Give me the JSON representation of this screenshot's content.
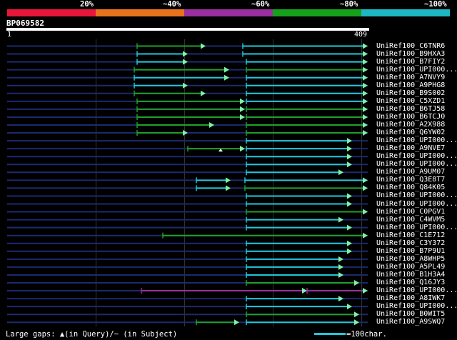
{
  "percent_scale": {
    "labels": [
      "20%",
      "~40%",
      "~60%",
      "~80%",
      "~100%"
    ],
    "colors": [
      "#e8163a",
      "#e9731d",
      "#9a2f9f",
      "#16a11c",
      "#1cb9c4"
    ]
  },
  "query": {
    "name": "BP069582",
    "start": "1",
    "end": "409"
  },
  "hits": [
    {
      "label": "UniRef100_C6TNR6"
    },
    {
      "label": "UniRef100_B9HXA3"
    },
    {
      "label": "UniRef100_B7FIY2"
    },
    {
      "label": "UniRef100_UPI000..."
    },
    {
      "label": "UniRef100_A7NVY9"
    },
    {
      "label": "UniRef100_A9PHG8"
    },
    {
      "label": "UniRef100_B9S002"
    },
    {
      "label": "UniRef100_C5XZD1"
    },
    {
      "label": "UniRef100_B6TJ58"
    },
    {
      "label": "UniRef100_B6TCJ0"
    },
    {
      "label": "UniRef100_A2X988"
    },
    {
      "label": "UniRef100_Q6YW02"
    },
    {
      "label": "UniRef100_UPI000..."
    },
    {
      "label": "UniRef100_A9NVE7"
    },
    {
      "label": "UniRef100_UPI000..."
    },
    {
      "label": "UniRef100_UPI000..."
    },
    {
      "label": "UniRef100_A9UM07"
    },
    {
      "label": "UniRef100_Q3E8T7"
    },
    {
      "label": "UniRef100_Q84K05"
    },
    {
      "label": "UniRef100_UPI000..."
    },
    {
      "label": "UniRef100_UPI000..."
    },
    {
      "label": "UniRef100_C0PGV1"
    },
    {
      "label": "UniRef100_C4WVM5"
    },
    {
      "label": "UniRef100_UPI000..."
    },
    {
      "label": "UniRef100_C1E712"
    },
    {
      "label": "UniRef100_C3Y372"
    },
    {
      "label": "UniRef100_B7P9U1"
    },
    {
      "label": "UniRef100_A8WHP5"
    },
    {
      "label": "UniRef100_A5PL49"
    },
    {
      "label": "UniRef100_B1H3A4"
    },
    {
      "label": "UniRef100_Q16JY3"
    },
    {
      "label": "UniRef100_UPI000..."
    },
    {
      "label": "UniRef100_A8IWK7"
    },
    {
      "label": "UniRef100_UPI000..."
    },
    {
      "label": "UniRef100_B0WIT5"
    },
    {
      "label": "UniRef100_A9SWQ7"
    }
  ],
  "footer": {
    "gaps_text": "Large gaps: ▲(in Query)/− (in Subject)",
    "legend_text": "=100char."
  }
}
